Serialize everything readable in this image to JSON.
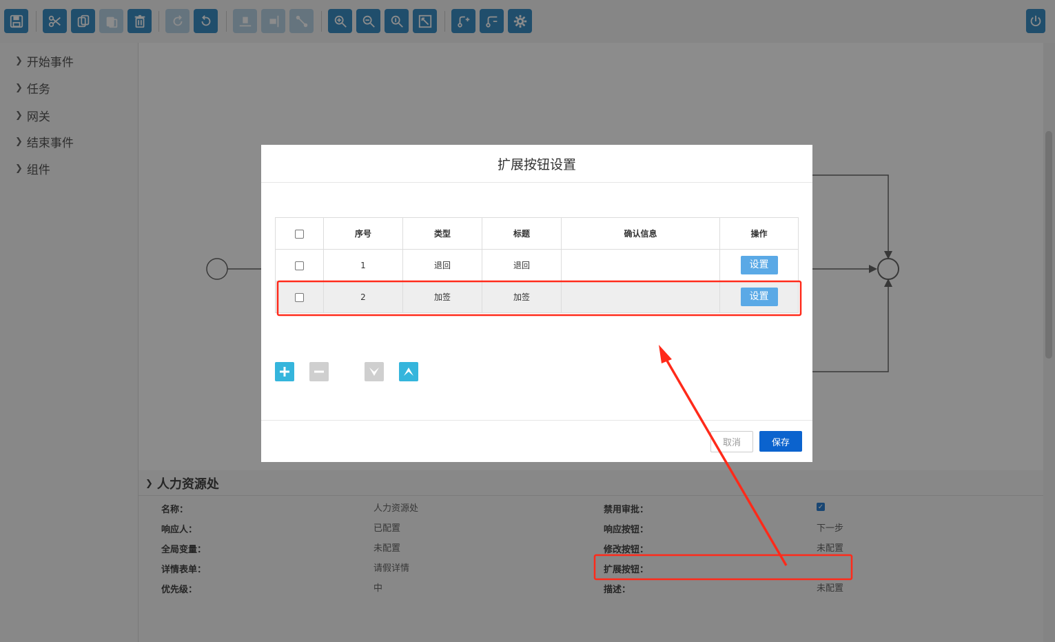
{
  "toolbar": {
    "buttons": [
      "save-icon",
      "cut-icon",
      "copy-icon",
      "paste-icon",
      "delete-icon",
      "redo-icon",
      "undo-icon",
      "align-bottom-icon",
      "align-right-icon",
      "connect-icon",
      "zoom-in-icon",
      "zoom-out-icon",
      "zoom-actual-icon",
      "fit-screen-icon",
      "add-flow-icon",
      "edit-flow-icon",
      "gear-icon",
      "power-icon"
    ]
  },
  "sidebar": {
    "items": [
      {
        "label": "开始事件"
      },
      {
        "label": "任务"
      },
      {
        "label": "网关"
      },
      {
        "label": "结束事件"
      },
      {
        "label": "组件"
      }
    ]
  },
  "properties": {
    "title": "人力资源处",
    "left": [
      {
        "label": "名称：",
        "value": "人力资源处"
      },
      {
        "label": "响应人：",
        "value": "已配置"
      },
      {
        "label": "全局变量：",
        "value": "未配置"
      },
      {
        "label": "详情表单：",
        "value": "请假详情"
      },
      {
        "label": "优先级：",
        "value": "中"
      }
    ],
    "right": [
      {
        "label": "禁用审批：",
        "value": ""
      },
      {
        "label": "响应按钮：",
        "value": "下一步"
      },
      {
        "label": "修改按钮：",
        "value": "未配置"
      },
      {
        "label": "扩展按钮：",
        "value": ""
      },
      {
        "label": "描述：",
        "value": "未配置"
      }
    ],
    "disable_approval_checked": true
  },
  "modal": {
    "title": "扩展按钮设置",
    "columns": [
      "序号",
      "类型",
      "标题",
      "确认信息",
      "操作"
    ],
    "rows": [
      {
        "index": "1",
        "type": "退回",
        "title": "退回",
        "confirm": "",
        "action": "设置"
      },
      {
        "index": "2",
        "type": "加签",
        "title": "加签",
        "confirm": "",
        "action": "设置"
      }
    ],
    "cancel_label": "取消",
    "save_label": "保存"
  },
  "colors": {
    "accent": "#3b8ec5",
    "save": "#0b63ce",
    "set_button": "#5aa9e6",
    "annotation": "#ff2a1a"
  }
}
